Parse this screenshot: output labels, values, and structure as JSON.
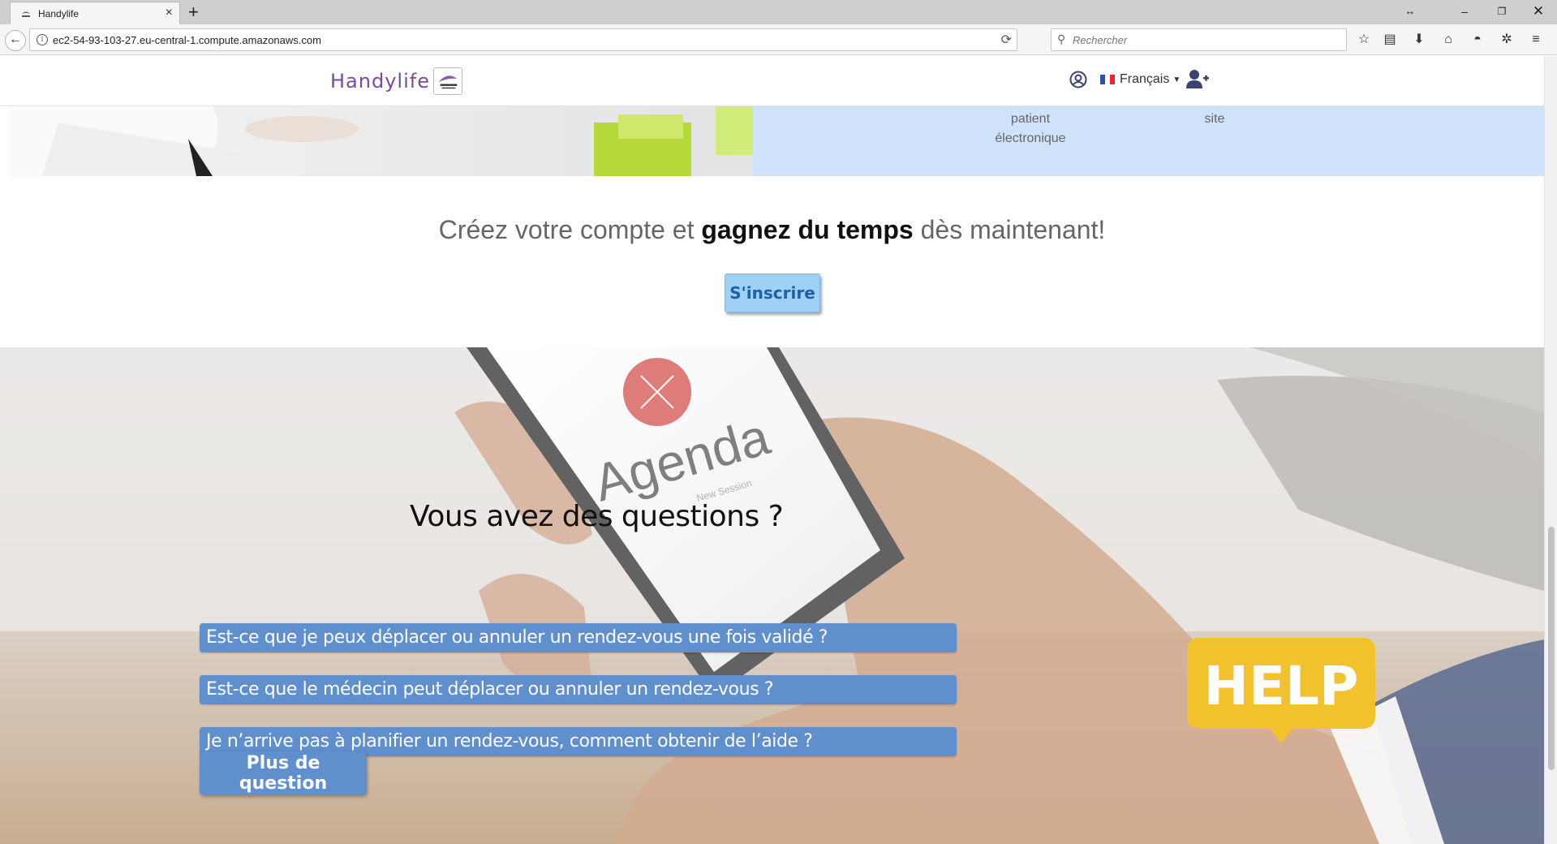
{
  "browser": {
    "tab_title": "Handylife",
    "url": "ec2-54-93-103-27.eu-central-1.compute.amazonaws.com",
    "search_placeholder": "Rechercher"
  },
  "header": {
    "logo_text": "Handylife",
    "language": "Français",
    "colors": {
      "logo": "#7b4a9c"
    }
  },
  "features": {
    "item1_line1": "patient",
    "item1_line2": "électronique",
    "item2": "site"
  },
  "cta": {
    "title_start": "Créez votre compte et ",
    "title_bold": "gagnez du temps",
    "title_end": " dès maintenant!",
    "signup_label": "S'inscrire"
  },
  "faq": {
    "title": "Vous avez des questions ?",
    "questions": [
      "Est-ce que je peux déplacer ou annuler un rendez-vous une fois validé ?",
      "Est-ce que le médecin peut déplacer ou annuler un rendez-vous ?",
      "Je n’arrive pas à planifier un rendez-vous, comment obtenir de l’aide ?"
    ],
    "more_label": "Plus de question",
    "image_agenda_text": "Agenda",
    "image_agenda_subtext": "New Session",
    "help_badge": "HELP",
    "colors": {
      "button": "#5f8fcd",
      "help": "#f2c22c"
    }
  }
}
